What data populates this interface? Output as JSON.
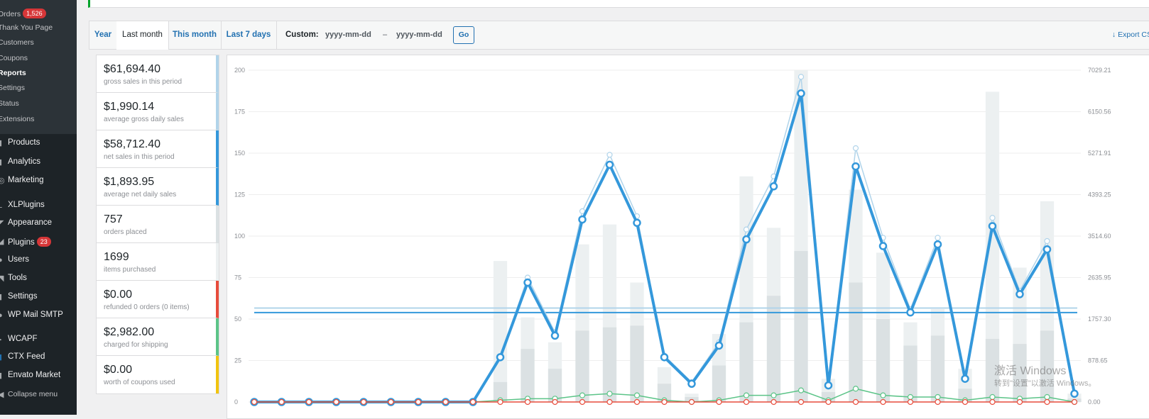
{
  "sidebar": {
    "submenu": [
      {
        "label": "Orders",
        "badge": "1,526"
      },
      {
        "label": "Thank You Page"
      },
      {
        "label": "Customers"
      },
      {
        "label": "Coupons"
      },
      {
        "label": "Reports",
        "current": true
      },
      {
        "label": "Settings"
      },
      {
        "label": "Status"
      },
      {
        "label": "Extensions"
      }
    ],
    "menu": [
      {
        "label": "Products",
        "icon": "products-icon"
      },
      {
        "label": "Analytics",
        "icon": "analytics-icon"
      },
      {
        "label": "Marketing",
        "icon": "marketing-icon"
      },
      {
        "label": "XLPlugins",
        "icon": "xlplugins-icon"
      },
      {
        "label": "Appearance",
        "icon": "appearance-icon"
      },
      {
        "label": "Plugins",
        "icon": "plugins-icon",
        "badge": "23"
      },
      {
        "label": "Users",
        "icon": "users-icon"
      },
      {
        "label": "Tools",
        "icon": "tools-icon"
      },
      {
        "label": "Settings",
        "icon": "settings-icon"
      },
      {
        "label": "WP Mail SMTP",
        "icon": "wp-mail-smtp-icon"
      },
      {
        "label": "WCAPF",
        "icon": "wcapf-icon"
      },
      {
        "label": "CTX Feed",
        "icon": "ctx-feed-icon"
      },
      {
        "label": "Envato Market",
        "icon": "envato-market-icon"
      },
      {
        "label": "Collapse menu",
        "icon": "collapse-icon"
      }
    ]
  },
  "tabs": {
    "items": [
      {
        "label": "Year"
      },
      {
        "label": "Last month",
        "active": true
      },
      {
        "label": "This month"
      },
      {
        "label": "Last 7 days"
      }
    ],
    "custom_label": "Custom:",
    "date_from_placeholder": "yyyy-mm-dd",
    "date_separator": "–",
    "date_to_placeholder": "yyyy-mm-dd",
    "go_label": "Go",
    "export_label": "Export CSV"
  },
  "stats": [
    {
      "value": "$61,694.40",
      "desc": "gross sales in this period",
      "color": "#b1d4ea"
    },
    {
      "value": "$1,990.14",
      "desc": "average gross daily sales",
      "color": "#b1d4ea"
    },
    {
      "value": "$58,712.40",
      "desc": "net sales in this period",
      "color": "#3498db"
    },
    {
      "value": "$1,893.95",
      "desc": "average net daily sales",
      "color": "#3498db"
    },
    {
      "value": "757",
      "desc": "orders placed",
      "color": "#dbe1e3"
    },
    {
      "value": "1699",
      "desc": "items purchased",
      "color": "#ecf0f1"
    },
    {
      "value": "$0.00",
      "desc": "refunded 0 orders (0 items)",
      "color": "#e74c3c"
    },
    {
      "value": "$2,982.00",
      "desc": "charged for shipping",
      "color": "#5cc488"
    },
    {
      "value": "$0.00",
      "desc": "worth of coupons used",
      "color": "#f1c40f"
    }
  ],
  "chart_data": {
    "type": "line",
    "left_ticks": [
      "0",
      "25",
      "50",
      "75",
      "100",
      "125",
      "150",
      "175",
      "200"
    ],
    "right_ticks": [
      "0.00",
      "878.65",
      "1757.30",
      "2635.95",
      "3514.60",
      "4393.25",
      "5271.91",
      "6150.56",
      "7029.21"
    ],
    "ylim": [
      0,
      200
    ],
    "y2lim": [
      0,
      7029.21
    ],
    "x_count": 31,
    "series": [
      {
        "type": "bar",
        "color": "#ecf0f1",
        "values": [
          0,
          0,
          0,
          0,
          0,
          0,
          0,
          0,
          0,
          85,
          51,
          36,
          95,
          107,
          72,
          21,
          5,
          41,
          136,
          105,
          200,
          14,
          128,
          90,
          48,
          56,
          20,
          187,
          81,
          121,
          5
        ]
      },
      {
        "type": "bar",
        "color": "#dbe1e3",
        "values": [
          0,
          0,
          0,
          0,
          0,
          0,
          0,
          0,
          0,
          12,
          32,
          20,
          43,
          45,
          46,
          11,
          3,
          22,
          48,
          64,
          91,
          6,
          72,
          50,
          34,
          40,
          8,
          38,
          35,
          43,
          2
        ]
      },
      {
        "type": "line",
        "color": "#b1d4ea",
        "values": [
          0,
          0,
          0,
          0,
          0,
          0,
          0,
          0,
          0,
          27,
          75,
          42,
          115,
          149,
          112,
          28,
          12,
          36,
          104,
          136,
          196,
          11,
          153,
          99,
          56,
          99,
          15,
          111,
          67,
          97,
          5
        ]
      },
      {
        "type": "line",
        "color": "#3498db",
        "values": [
          0,
          0,
          0,
          0,
          0,
          0,
          0,
          0,
          0,
          27,
          72,
          40,
          110,
          143,
          108,
          27,
          11,
          34,
          98,
          130,
          186,
          10,
          142,
          94,
          54,
          95,
          14,
          106,
          65,
          92,
          5
        ]
      },
      {
        "type": "line",
        "color": "#5cc488",
        "values": [
          0,
          0,
          0,
          0,
          0,
          0,
          0,
          0,
          0,
          1,
          2,
          2,
          4,
          5,
          4,
          1,
          0,
          1,
          4,
          4,
          7,
          1,
          8,
          4,
          3,
          3,
          1,
          3,
          2,
          3,
          0
        ]
      },
      {
        "type": "line",
        "color": "#e74c3c",
        "values": [
          0,
          0,
          0,
          0,
          0,
          0,
          0,
          0,
          0,
          0,
          0,
          0,
          0,
          0,
          0,
          0,
          0,
          0,
          0,
          0,
          0,
          0,
          0,
          0,
          0,
          0,
          0,
          0,
          0,
          0,
          0
        ]
      }
    ],
    "average_gross": 1990.14,
    "average_net": 1893.95
  },
  "watermark": {
    "line1": "激活 Windows",
    "line2": "转到\"设置\"以激活 Windows。"
  }
}
